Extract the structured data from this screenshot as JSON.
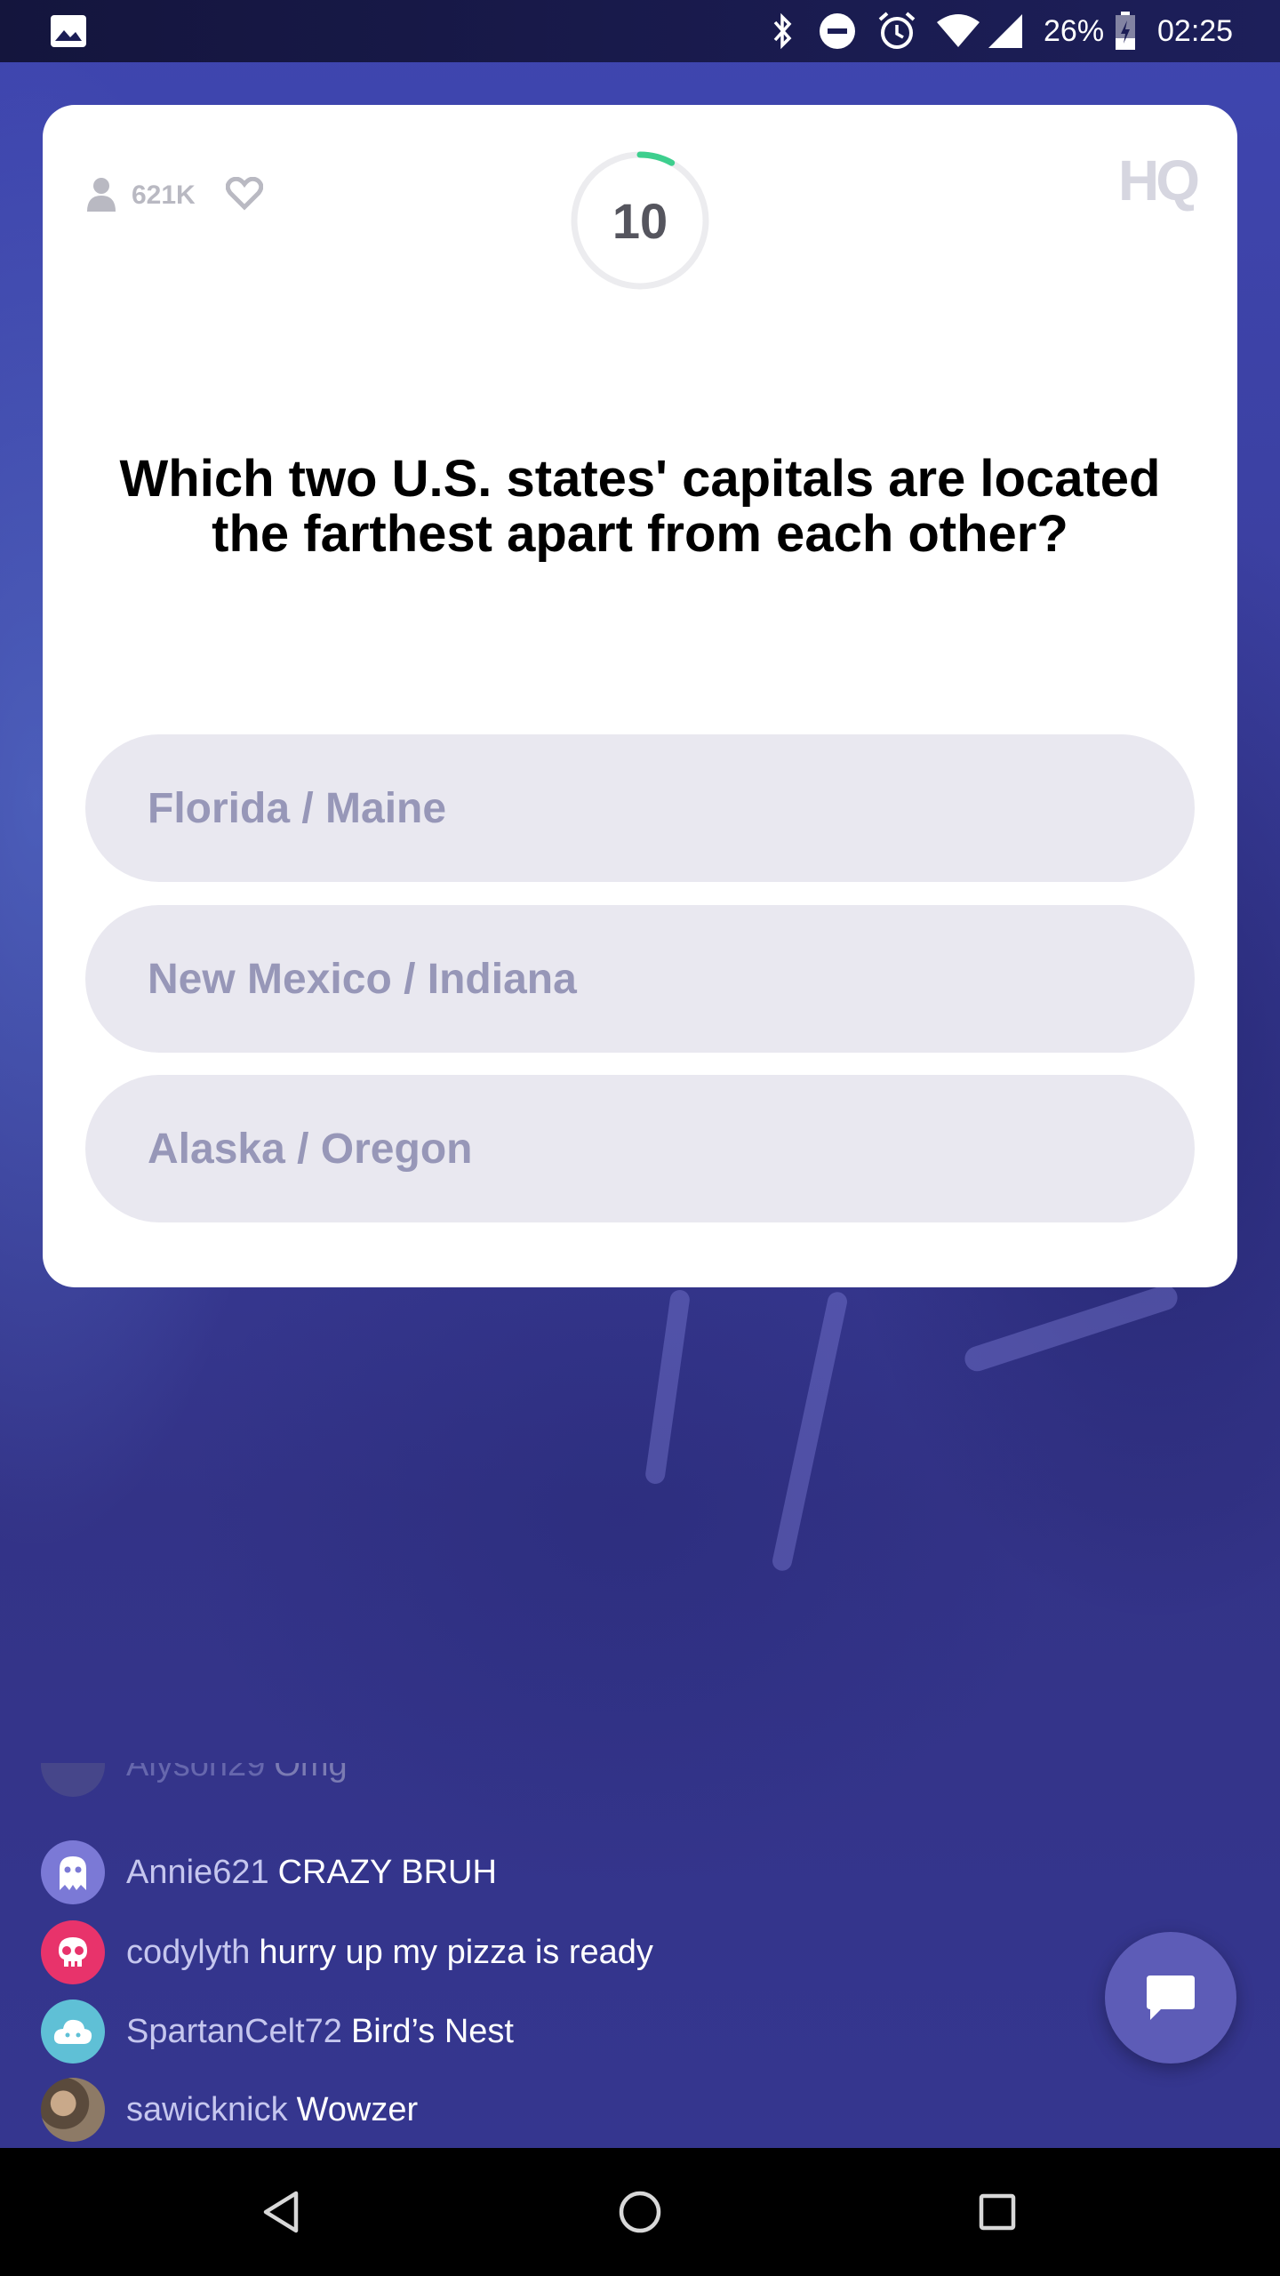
{
  "status_bar": {
    "battery_percent": "26%",
    "time": "02:25",
    "icons": [
      "image-icon",
      "bluetooth-icon",
      "dnd-icon",
      "alarm-icon",
      "wifi-icon",
      "signal-icon",
      "battery-charging-icon"
    ]
  },
  "game": {
    "viewer_count": "621K",
    "timer_value": "10",
    "timer_progress": 0.08,
    "logo": "HQ",
    "question": "Which two U.S. states' capitals are located the farthest apart from each other?",
    "answers": [
      "Florida / Maine",
      "New Mexico / Indiana",
      "Alaska / Oregon"
    ]
  },
  "chat": {
    "partial_row": {
      "user": "Alyson29",
      "message": "Omg"
    },
    "messages": [
      {
        "user": "Annie621",
        "message": "CRAZY BRUH",
        "avatar_color": "#7b79d6",
        "avatar_icon": "ghost-icon"
      },
      {
        "user": "codylyth",
        "message": "hurry up my pizza is ready",
        "avatar_color": "#e8336b",
        "avatar_icon": "skull-icon"
      },
      {
        "user": "SpartanCelt72",
        "message": "Bird’s Nest",
        "avatar_color": "#5fc0d6",
        "avatar_icon": "cloud-icon"
      },
      {
        "user": "sawicknick",
        "message": "Wowzer",
        "avatar_color": "#7a6a5a",
        "avatar_icon": "photo-avatar"
      }
    ]
  },
  "colors": {
    "timer_arc": "#3dcf8e",
    "answer_bg": "#e9e8f0",
    "answer_text": "#9797b8",
    "chat_button": "#5d5cb7"
  }
}
